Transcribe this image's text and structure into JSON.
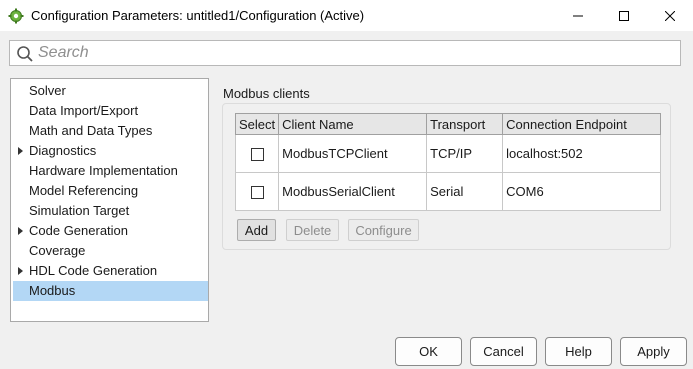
{
  "window": {
    "title": "Configuration Parameters: untitled1/Configuration (Active)",
    "icon": "simulink-gear-icon"
  },
  "search": {
    "placeholder": "Search",
    "value": ""
  },
  "tree": {
    "items": [
      {
        "label": "Solver",
        "expandable": false,
        "selected": false
      },
      {
        "label": "Data Import/Export",
        "expandable": false,
        "selected": false
      },
      {
        "label": "Math and Data Types",
        "expandable": false,
        "selected": false
      },
      {
        "label": "Diagnostics",
        "expandable": true,
        "selected": false
      },
      {
        "label": "Hardware Implementation",
        "expandable": false,
        "selected": false
      },
      {
        "label": "Model Referencing",
        "expandable": false,
        "selected": false
      },
      {
        "label": "Simulation Target",
        "expandable": false,
        "selected": false
      },
      {
        "label": "Code Generation",
        "expandable": true,
        "selected": false
      },
      {
        "label": "Coverage",
        "expandable": false,
        "selected": false
      },
      {
        "label": "HDL Code Generation",
        "expandable": true,
        "selected": false
      },
      {
        "label": "Modbus",
        "expandable": false,
        "selected": true
      }
    ]
  },
  "panel": {
    "title": "Modbus clients",
    "columns": [
      "Select",
      "Client Name",
      "Transport",
      "Connection Endpoint"
    ],
    "rows": [
      {
        "checked": false,
        "name": "ModbusTCPClient",
        "transport": "TCP/IP",
        "endpoint": "localhost:502"
      },
      {
        "checked": false,
        "name": "ModbusSerialClient",
        "transport": "Serial",
        "endpoint": "COM6"
      }
    ],
    "buttons": {
      "add": "Add",
      "delete": "Delete",
      "configure": "Configure"
    }
  },
  "dialog_buttons": {
    "ok": "OK",
    "cancel": "Cancel",
    "help": "Help",
    "apply": "Apply"
  },
  "colors": {
    "selection": "#b3d7f5",
    "title_bar": "#ffffff",
    "background": "#f0f0f0"
  }
}
